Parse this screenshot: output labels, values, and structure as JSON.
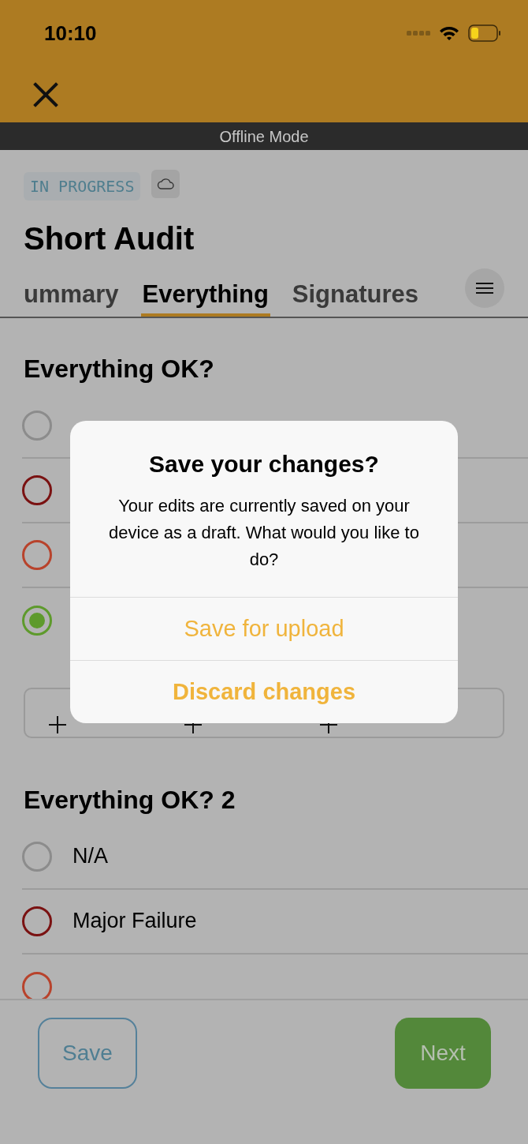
{
  "status_bar": {
    "time": "10:10"
  },
  "banner": {
    "text": "Offline Mode"
  },
  "status_badge": {
    "text": "IN PROGRESS"
  },
  "title": "Short Audit",
  "tabs": [
    {
      "label": "ummary",
      "selected": false
    },
    {
      "label": "Everything",
      "selected": true
    },
    {
      "label": "Signatures",
      "selected": false
    }
  ],
  "questions": [
    {
      "title": "Everything OK?",
      "options": [
        {
          "color": "#8c8c8c",
          "selected": false
        },
        {
          "color": "#7a1212",
          "selected": false
        },
        {
          "color": "#b8432c",
          "selected": false
        },
        {
          "color": "#5e9a2c",
          "selected": true
        }
      ],
      "add_buttons": [
        {
          "kind": "add"
        },
        {
          "kind": "add"
        },
        {
          "kind": "add"
        }
      ]
    },
    {
      "title": "Everything OK? 2",
      "options": [
        {
          "label": "N/A",
          "color": "#8c8c8c",
          "selected": false
        },
        {
          "label": "Major Failure",
          "color": "#7a1212",
          "selected": false
        },
        {
          "color": "#b8432c",
          "selected": false
        }
      ]
    }
  ],
  "footer": {
    "save": "Save",
    "next": "Next"
  },
  "dialog": {
    "title": "Save your changes?",
    "message": "Your edits are currently saved on your device as a draft. What would you like to do?",
    "actions": [
      {
        "label": "Save for upload",
        "kind": "default"
      },
      {
        "label": "Discard changes",
        "kind": "bold"
      }
    ]
  }
}
